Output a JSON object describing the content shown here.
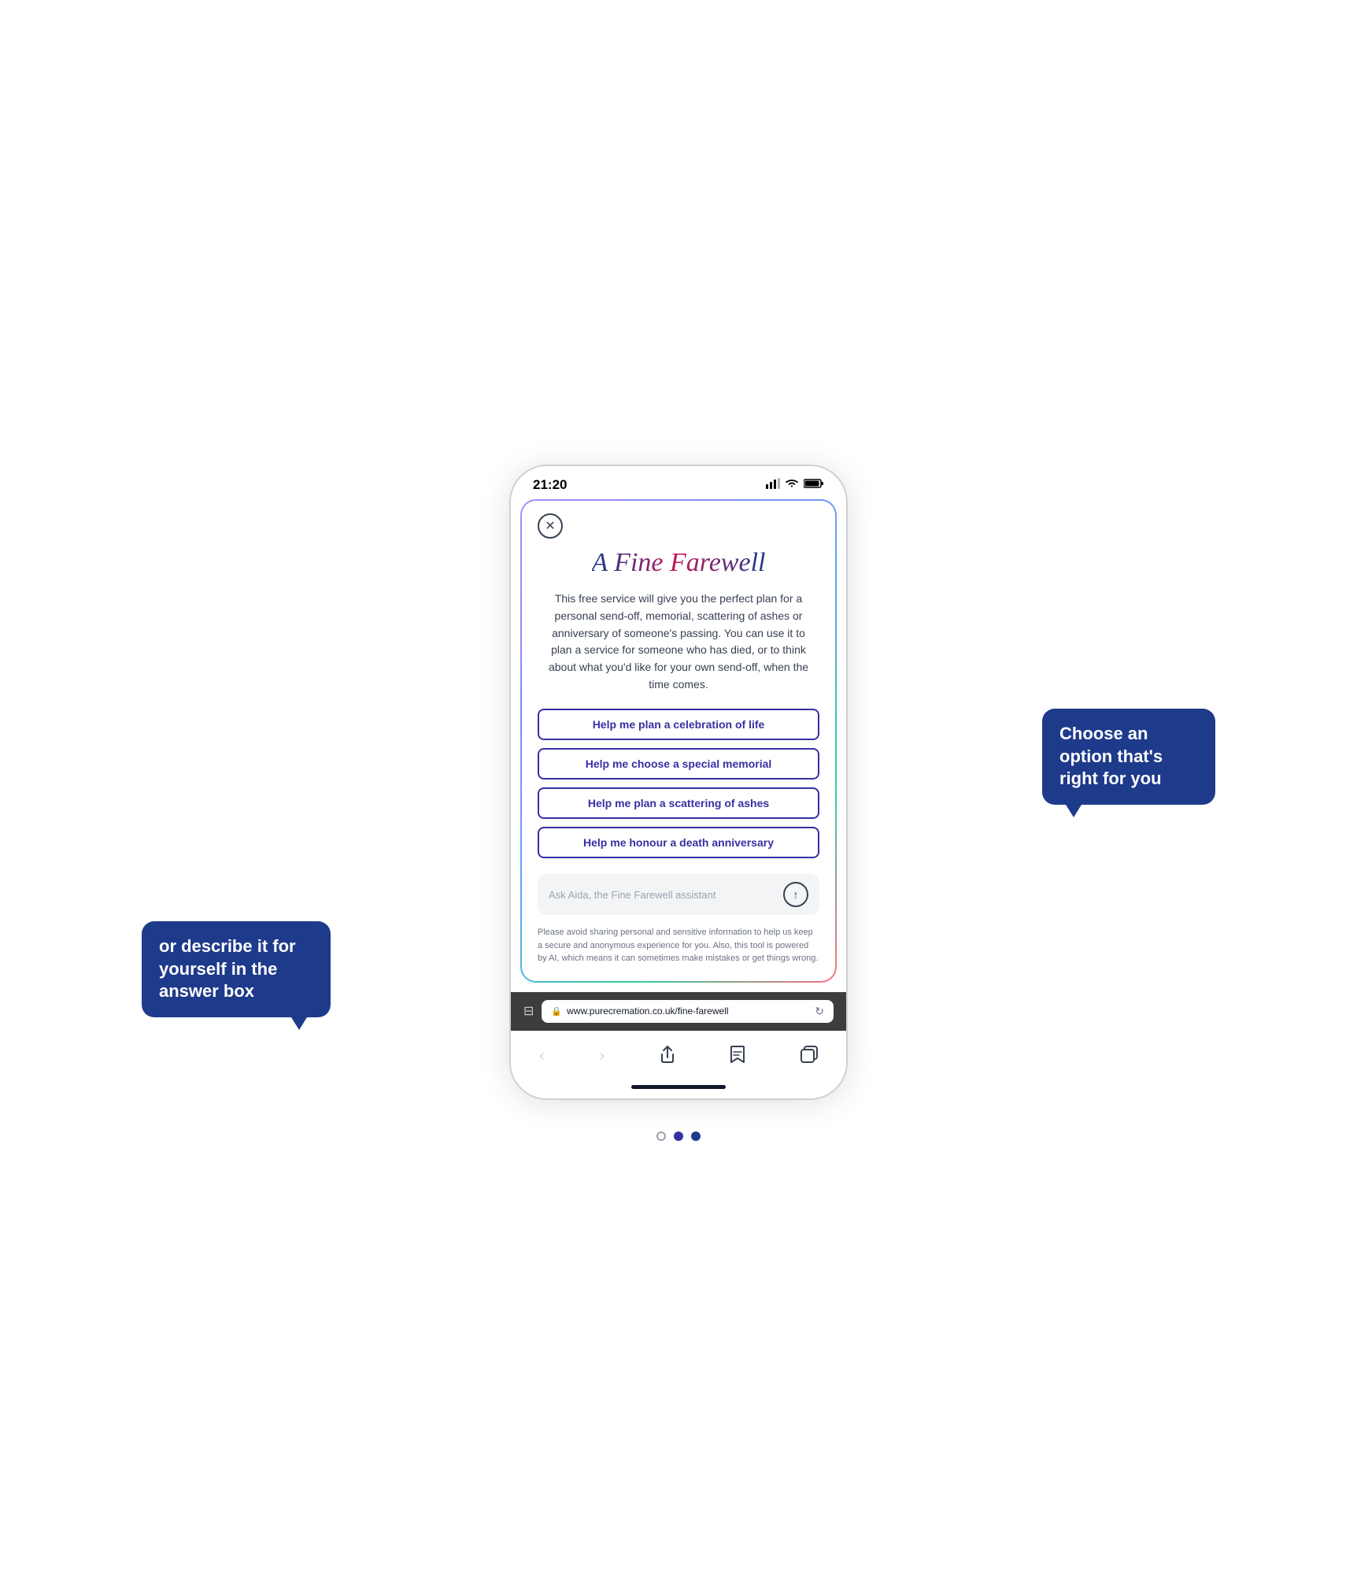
{
  "status_bar": {
    "time": "21:20"
  },
  "callout_right": {
    "text": "Choose an option that's right for you"
  },
  "callout_left": {
    "text": "or describe it for yourself in the answer box"
  },
  "app": {
    "logo": "A Fine Farewell",
    "description": "This free service will give you the perfect plan for a personal send-off, memorial, scattering of ashes or anniversary of someone's passing. You can use it to plan a service for someone who has died, or to think about what you'd like for your own send-off, when the time comes.",
    "options": [
      "Help me plan a celebration of life",
      "Help me choose a special memorial",
      "Help me plan a scattering of ashes",
      "Help me honour a death anniversary"
    ],
    "input_placeholder": "Ask Aida, the Fine Farewell assistant",
    "disclaimer": "Please avoid sharing personal and sensitive information to help us keep a secure and anonymous experience for you. Also, this tool is powered by AI, which means it can sometimes make mistakes or get things wrong."
  },
  "browser": {
    "url": "www.purecremation.co.uk/fine-farewell"
  },
  "nav": {
    "back": "‹",
    "forward": "›",
    "share": "⬆",
    "bookmarks": "⊓",
    "tabs": "⧉"
  },
  "dots": [
    {
      "type": "empty"
    },
    {
      "type": "filled-blue"
    },
    {
      "type": "filled-dark"
    }
  ]
}
